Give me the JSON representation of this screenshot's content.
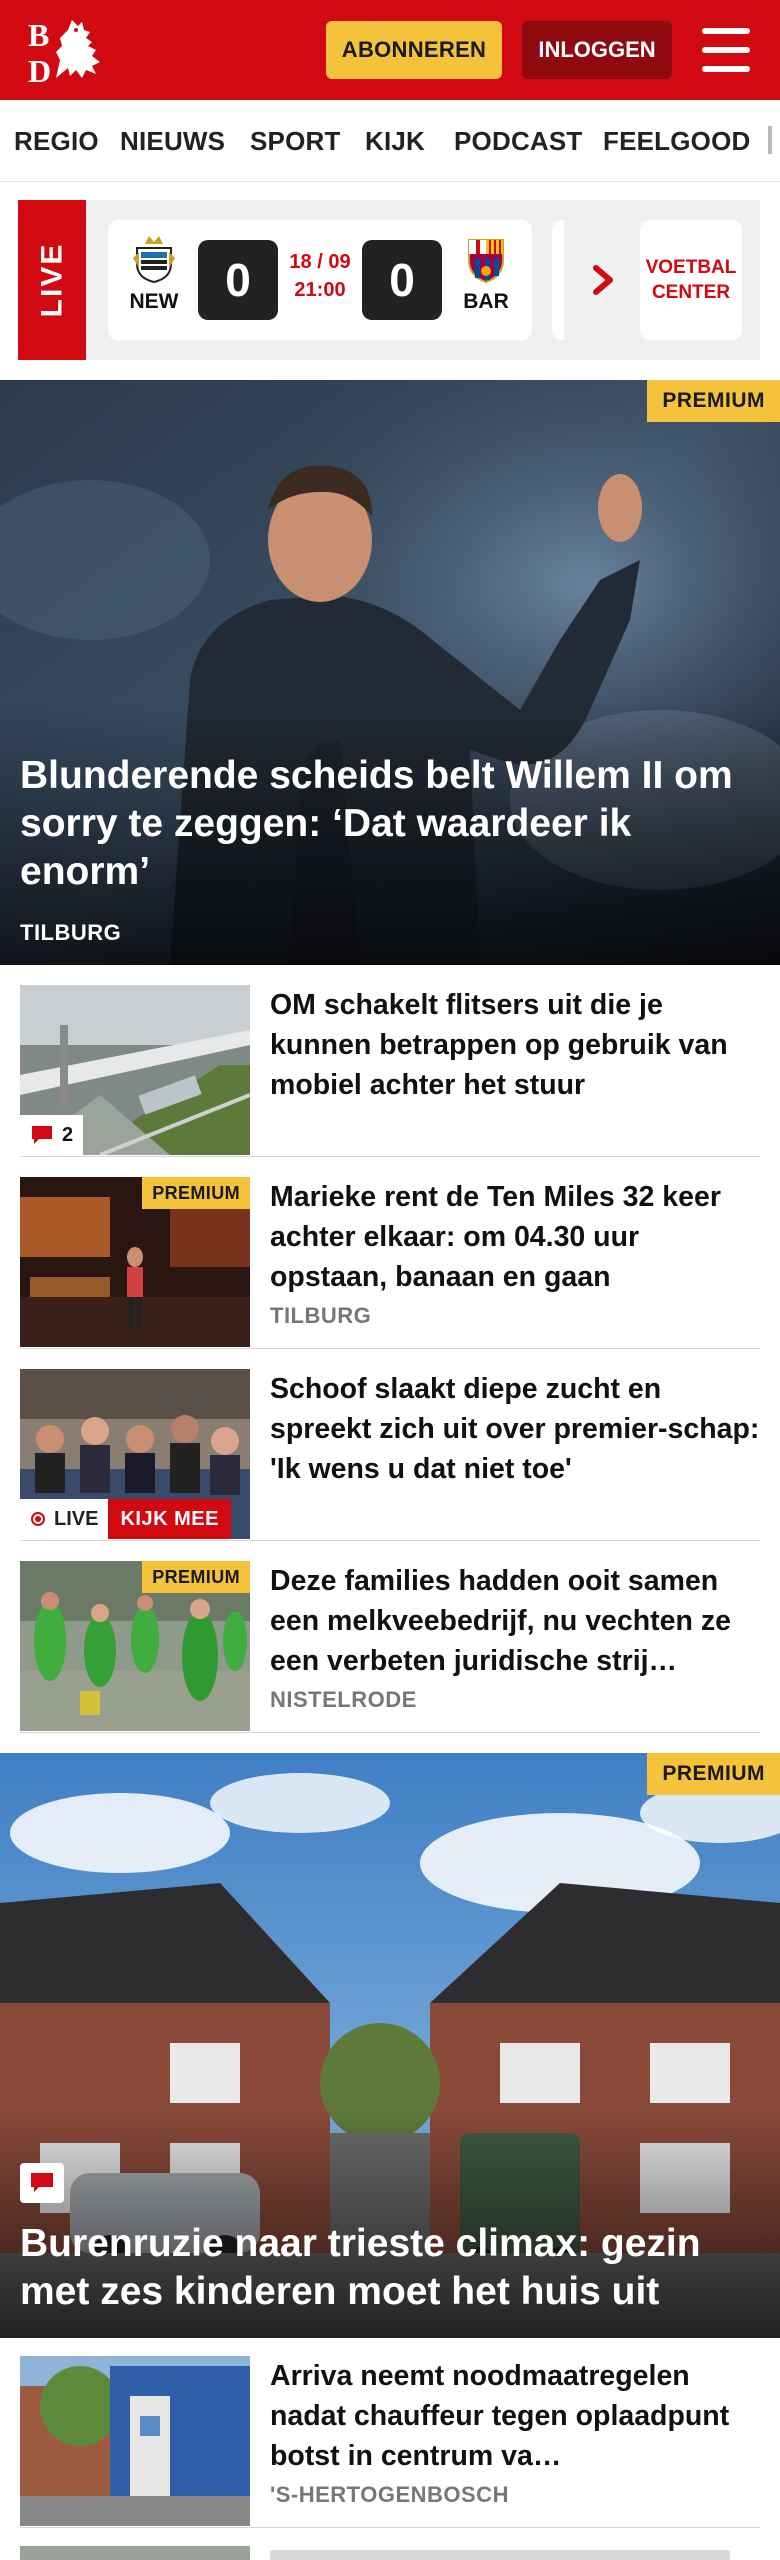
{
  "header": {
    "logo_text": "BD",
    "subscribe_label": "ABONNEREN",
    "login_label": "INLOGGEN"
  },
  "nav": {
    "items": [
      "REGIO",
      "NIEUWS",
      "SPORT",
      "KIJK",
      "PODCAST",
      "FEELGOOD"
    ]
  },
  "live_strip": {
    "live_label": "LIVE",
    "match": {
      "home": "NEW",
      "away": "BAR",
      "home_score": "0",
      "away_score": "0",
      "date": "18 / 09",
      "time": "21:00"
    },
    "voetbal_center": "VOETBAL CENTER"
  },
  "hero1": {
    "badge": "PREMIUM",
    "title": "Blunderende scheids belt Willem II om sorry te zeggen: ‘Dat waardeer ik enorm’",
    "place": "TILBURG"
  },
  "articles": [
    {
      "title": "OM schakelt flitsers uit die je kunnen betrappen op gebruik van mobiel achter het stuur",
      "place": "",
      "comments": "2"
    },
    {
      "title": "Marieke rent de Ten Miles 32 keer achter elkaar: om 04.30 uur opstaan, banaan en gaan",
      "place": "TILBURG",
      "badge": "PREMIUM"
    },
    {
      "title": "Schoof slaakt diepe zucht en spreekt zich uit over premier-schap: 'Ik wens u dat niet toe'",
      "place": "",
      "live_label": "LIVE",
      "watch_label": "KIJK MEE"
    },
    {
      "title": "Deze families hadden ooit samen een melkveebedrijf, nu vechten ze een verbeten juridische strij…",
      "place": "NISTELRODE",
      "badge": "PREMIUM"
    }
  ],
  "hero2": {
    "badge": "PREMIUM",
    "title": "Burenruzie naar trieste climax: gezin met zes kinderen moet het huis uit"
  },
  "articles2": [
    {
      "title": "Arriva neemt noodmaatregelen nadat chauffeur tegen oplaadpunt botst in centrum va…",
      "place": "'S-HERTOGENBOSCH"
    }
  ],
  "colors": {
    "brand_red": "#d10a11",
    "premium_yellow": "#f5c33b",
    "login_dark_red": "#8e0a10"
  }
}
